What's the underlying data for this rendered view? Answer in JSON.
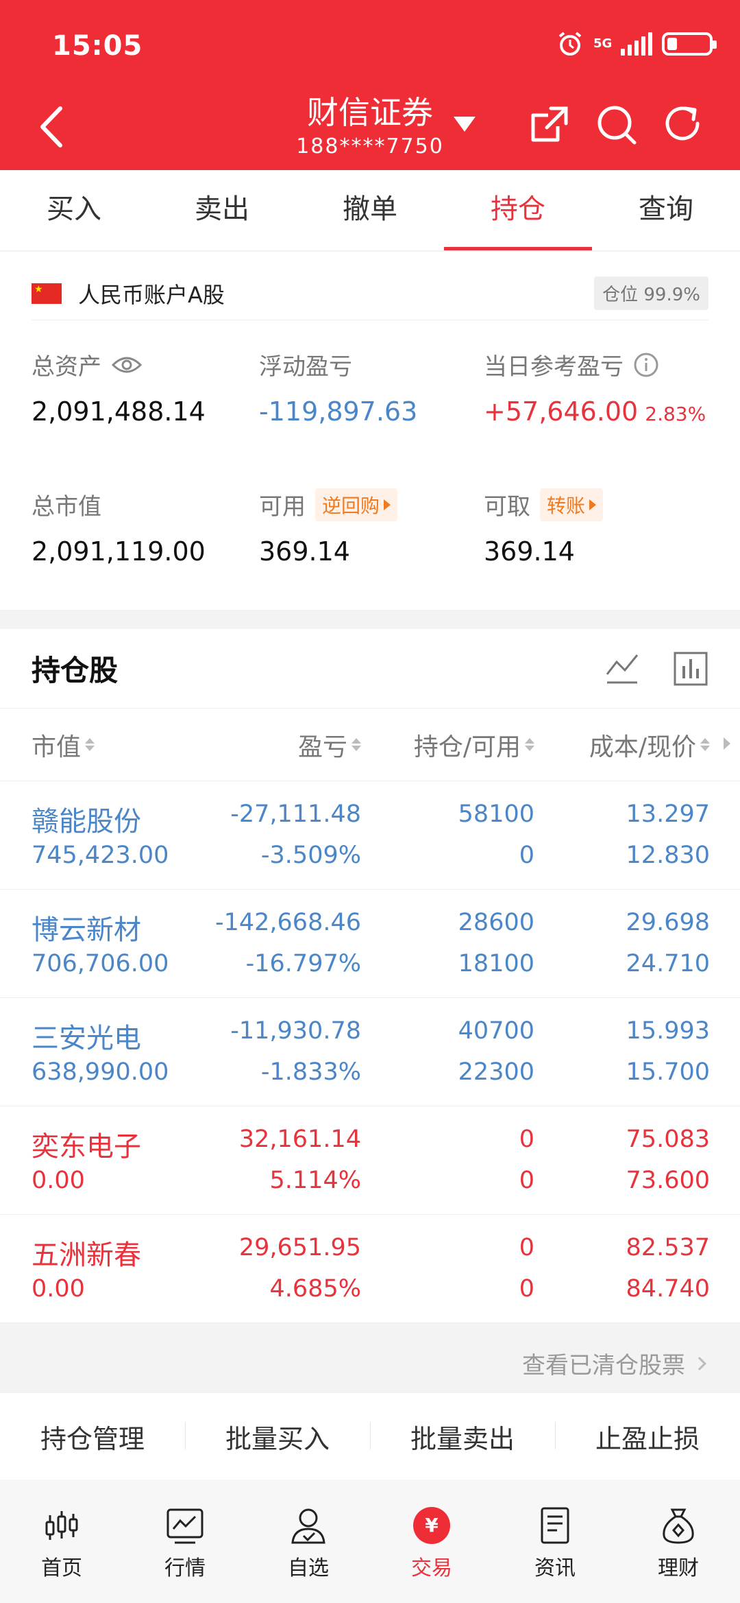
{
  "status_bar": {
    "time": "15:05",
    "network": "5G"
  },
  "header": {
    "title": "财信证券",
    "account": "188****7750"
  },
  "tabs": [
    "买入",
    "卖出",
    "撤单",
    "持仓",
    "查询"
  ],
  "active_tab_index": 3,
  "account": {
    "label": "人民币账户A股",
    "position_ratio": "仓位 99.9%",
    "total_assets_label": "总资产",
    "total_assets": "2,091,488.14",
    "floating_pl_label": "浮动盈亏",
    "floating_pl": "-119,897.63",
    "daily_pl_label": "当日参考盈亏",
    "daily_pl": "+57,646.00",
    "daily_pl_pct": "2.83%",
    "market_value_label": "总市值",
    "market_value": "2,091,119.00",
    "available_label": "可用",
    "available_link": "逆回购",
    "available": "369.14",
    "withdrawable_label": "可取",
    "withdrawable_link": "转账",
    "withdrawable": "369.14"
  },
  "holdings": {
    "title": "持仓股",
    "columns": [
      "市值",
      "盈亏",
      "持仓/可用",
      "成本/现价"
    ],
    "rows": [
      {
        "name": "赣能股份",
        "market_value": "745,423.00",
        "pl": "-27,111.48",
        "pl_pct": "-3.509%",
        "position": "58100",
        "available": "0",
        "cost": "13.297",
        "price": "12.830",
        "color": "#4a86c8"
      },
      {
        "name": "博云新材",
        "market_value": "706,706.00",
        "pl": "-142,668.46",
        "pl_pct": "-16.797%",
        "position": "28600",
        "available": "18100",
        "cost": "29.698",
        "price": "24.710",
        "color": "#4a86c8"
      },
      {
        "name": "三安光电",
        "market_value": "638,990.00",
        "pl": "-11,930.78",
        "pl_pct": "-1.833%",
        "position": "40700",
        "available": "22300",
        "cost": "15.993",
        "price": "15.700",
        "color": "#4a86c8"
      },
      {
        "name": "奕东电子",
        "market_value": "0.00",
        "pl": "32,161.14",
        "pl_pct": "5.114%",
        "position": "0",
        "available": "0",
        "cost": "75.083",
        "price": "73.600",
        "color": "#e8323c"
      },
      {
        "name": "五洲新春",
        "market_value": "0.00",
        "pl": "29,651.95",
        "pl_pct": "4.685%",
        "position": "0",
        "available": "0",
        "cost": "82.537",
        "price": "84.740",
        "color": "#e8323c"
      }
    ],
    "cleared_link": "查看已清仓股票"
  },
  "actions": [
    "持仓管理",
    "批量买入",
    "批量卖出",
    "止盈止损"
  ],
  "bottom_nav": [
    {
      "label": "首页",
      "icon": "candlestick-icon"
    },
    {
      "label": "行情",
      "icon": "market-chart-icon"
    },
    {
      "label": "自选",
      "icon": "watchlist-user-icon"
    },
    {
      "label": "交易",
      "icon": "yuan-trade-icon",
      "glyph": "¥"
    },
    {
      "label": "资讯",
      "icon": "news-document-icon"
    },
    {
      "label": "理财",
      "icon": "wealth-bag-icon"
    }
  ],
  "active_nav_index": 3,
  "colors": {
    "brand_red": "#ee2d36",
    "loss_blue": "#4a86c8",
    "gain_red": "#e8323c",
    "accent_orange": "#f07a20"
  }
}
